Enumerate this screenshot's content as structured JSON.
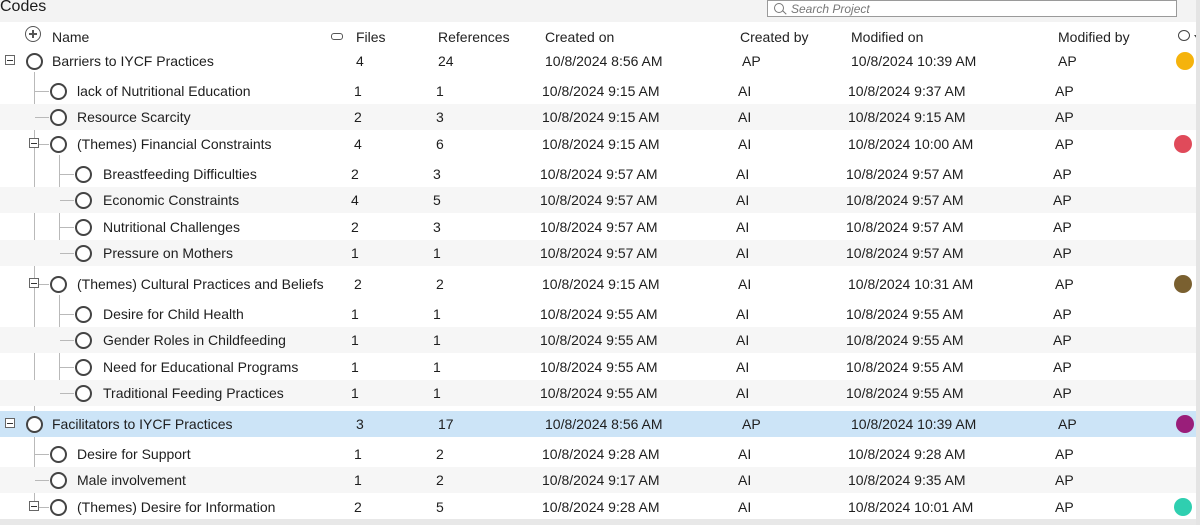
{
  "title": "Codes",
  "search": {
    "placeholder": "Search Project"
  },
  "columns": {
    "name": "Name",
    "files": "Files",
    "references": "References",
    "created_on": "Created on",
    "created_by": "Created by",
    "modified_on": "Modified on",
    "modified_by": "Modified by"
  },
  "icons": {
    "add": "plus-circle-icon",
    "link": "link-icon",
    "color": "palette-icon",
    "expander": "collapse-minus-icon",
    "radio": "circle-icon"
  },
  "colors": {
    "selection": "#cce4f7",
    "yellow": "#f5b30c",
    "red": "#e04a5a",
    "brown": "#7a6030",
    "purple": "#9a1e7a",
    "teal": "#2fcfb0"
  },
  "rows": [
    {
      "name": "Barriers to IYCF Practices",
      "files": "4",
      "refs": "24",
      "created_on": "10/8/2024 8:56 AM",
      "created_by": "AP",
      "modified_on": "10/8/2024 10:39 AM",
      "modified_by": "AP",
      "color": "#f5b30c"
    },
    {
      "name": "lack of Nutritional Education",
      "files": "1",
      "refs": "1",
      "created_on": "10/8/2024 9:15 AM",
      "created_by": "AI",
      "modified_on": "10/8/2024 9:37 AM",
      "modified_by": "AP",
      "color": ""
    },
    {
      "name": "Resource Scarcity",
      "files": "2",
      "refs": "3",
      "created_on": "10/8/2024 9:15 AM",
      "created_by": "AI",
      "modified_on": "10/8/2024 9:15 AM",
      "modified_by": "AP",
      "color": ""
    },
    {
      "name": "(Themes) Financial Constraints",
      "files": "4",
      "refs": "6",
      "created_on": "10/8/2024 9:15 AM",
      "created_by": "AI",
      "modified_on": "10/8/2024 10:00 AM",
      "modified_by": "AP",
      "color": "#e04a5a"
    },
    {
      "name": "Breastfeeding Difficulties",
      "files": "2",
      "refs": "3",
      "created_on": "10/8/2024 9:57 AM",
      "created_by": "AI",
      "modified_on": "10/8/2024 9:57 AM",
      "modified_by": "AP",
      "color": ""
    },
    {
      "name": "Economic Constraints",
      "files": "4",
      "refs": "5",
      "created_on": "10/8/2024 9:57 AM",
      "created_by": "AI",
      "modified_on": "10/8/2024 9:57 AM",
      "modified_by": "AP",
      "color": ""
    },
    {
      "name": "Nutritional Challenges",
      "files": "2",
      "refs": "3",
      "created_on": "10/8/2024 9:57 AM",
      "created_by": "AI",
      "modified_on": "10/8/2024 9:57 AM",
      "modified_by": "AP",
      "color": ""
    },
    {
      "name": "Pressure on Mothers",
      "files": "1",
      "refs": "1",
      "created_on": "10/8/2024 9:57 AM",
      "created_by": "AI",
      "modified_on": "10/8/2024 9:57 AM",
      "modified_by": "AP",
      "color": ""
    },
    {
      "name": "(Themes) Cultural Practices and Beliefs",
      "files": "2",
      "refs": "2",
      "created_on": "10/8/2024 9:15 AM",
      "created_by": "AI",
      "modified_on": "10/8/2024 10:31 AM",
      "modified_by": "AP",
      "color": "#7a6030"
    },
    {
      "name": "Desire for Child Health",
      "files": "1",
      "refs": "1",
      "created_on": "10/8/2024 9:55 AM",
      "created_by": "AI",
      "modified_on": "10/8/2024 9:55 AM",
      "modified_by": "AP",
      "color": ""
    },
    {
      "name": "Gender Roles in Childfeeding",
      "files": "1",
      "refs": "1",
      "created_on": "10/8/2024 9:55 AM",
      "created_by": "AI",
      "modified_on": "10/8/2024 9:55 AM",
      "modified_by": "AP",
      "color": ""
    },
    {
      "name": "Need for Educational Programs",
      "files": "1",
      "refs": "1",
      "created_on": "10/8/2024 9:55 AM",
      "created_by": "AI",
      "modified_on": "10/8/2024 9:55 AM",
      "modified_by": "AP",
      "color": ""
    },
    {
      "name": "Traditional Feeding Practices",
      "files": "1",
      "refs": "1",
      "created_on": "10/8/2024 9:55 AM",
      "created_by": "AI",
      "modified_on": "10/8/2024 9:55 AM",
      "modified_by": "AP",
      "color": ""
    },
    {
      "name": "Facilitators to IYCF Practices",
      "files": "3",
      "refs": "17",
      "created_on": "10/8/2024 8:56 AM",
      "created_by": "AP",
      "modified_on": "10/8/2024 10:39 AM",
      "modified_by": "AP",
      "color": "#9a1e7a"
    },
    {
      "name": "Desire for Support",
      "files": "1",
      "refs": "2",
      "created_on": "10/8/2024 9:28 AM",
      "created_by": "AI",
      "modified_on": "10/8/2024 9:28 AM",
      "modified_by": "AP",
      "color": ""
    },
    {
      "name": "Male involvement",
      "files": "1",
      "refs": "2",
      "created_on": "10/8/2024 9:17 AM",
      "created_by": "AI",
      "modified_on": "10/8/2024 9:35 AM",
      "modified_by": "AP",
      "color": ""
    },
    {
      "name": "(Themes) Desire for Information",
      "files": "2",
      "refs": "5",
      "created_on": "10/8/2024 9:28 AM",
      "created_by": "AI",
      "modified_on": "10/8/2024 10:01 AM",
      "modified_by": "AP",
      "color": "#2fcfb0"
    }
  ]
}
